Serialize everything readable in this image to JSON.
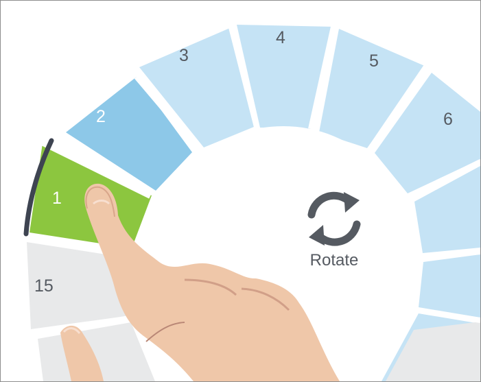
{
  "dial": {
    "segments": [
      {
        "label": "1",
        "state": "selected",
        "color": "#8cc63f"
      },
      {
        "label": "2",
        "state": "active",
        "color": "#8dc8e8"
      },
      {
        "label": "3",
        "state": "available",
        "color": "#c5e3f5"
      },
      {
        "label": "4",
        "state": "available",
        "color": "#c5e3f5"
      },
      {
        "label": "5",
        "state": "available",
        "color": "#c5e3f5"
      },
      {
        "label": "6",
        "state": "available",
        "color": "#c5e3f5"
      },
      {
        "label": "",
        "state": "available",
        "color": "#c5e3f5"
      },
      {
        "label": "",
        "state": "available",
        "color": "#c5e3f5"
      },
      {
        "label": "",
        "state": "available",
        "color": "#c5e3f5"
      },
      {
        "label": "15",
        "state": "unavailable",
        "color": "#e8e9ea"
      },
      {
        "label": "",
        "state": "unavailable",
        "color": "#e8e9ea"
      }
    ],
    "center": {
      "icon": "rotate-icon",
      "label": "Rotate"
    }
  },
  "colors": {
    "selected_segment": "#8cc63f",
    "active_segment": "#8dc8e8",
    "available_segment": "#c5e3f5",
    "unavailable_segment": "#e8e9ea",
    "icon": "#555a61",
    "selection_arc": "#3e4451"
  },
  "overlay": {
    "hand": "pointing-hand"
  }
}
